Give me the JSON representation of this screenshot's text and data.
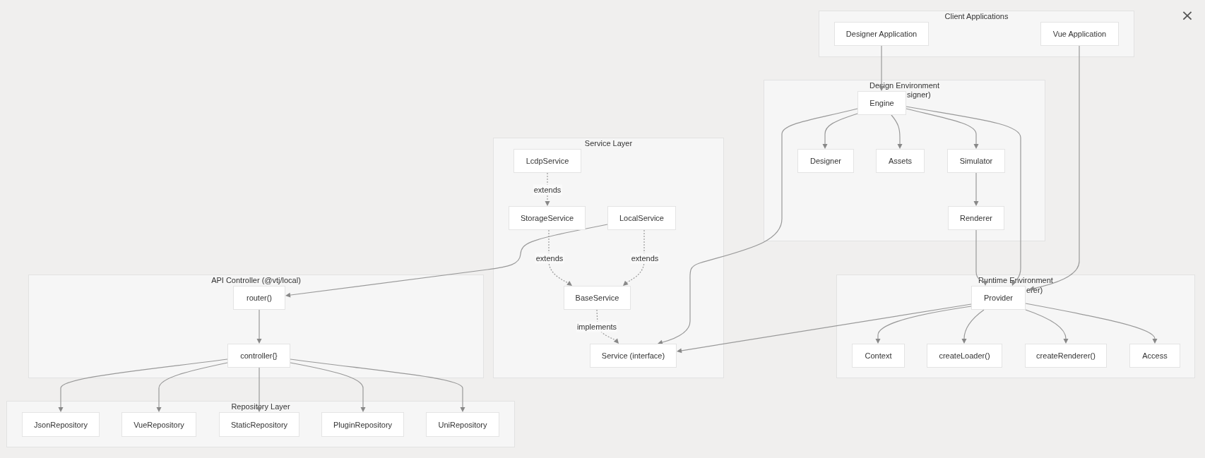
{
  "groups": [
    {
      "title": "Client Applications",
      "nodes": [
        "Designer Application",
        "Vue Application"
      ]
    },
    {
      "title": "Design Environment",
      "title_line_2": "signer)",
      "nodes": [
        "Engine",
        "Designer",
        "Assets",
        "Simulator",
        "Renderer"
      ]
    },
    {
      "title": "API Controller (@vtj/local)",
      "nodes": [
        "router()",
        "controller{}"
      ]
    },
    {
      "title": "Service Layer",
      "nodes": [
        "LcdpService",
        "StorageService",
        "LocalService",
        "BaseService",
        "Service (interface)"
      ]
    },
    {
      "title": "Runtime Environment",
      "title_line_2": "erer)",
      "nodes": [
        "Provider",
        "Context",
        "createLoader()",
        "createRenderer()",
        "Access"
      ]
    },
    {
      "title": "Repository Layer",
      "nodes": [
        "JsonRepository",
        "VueRepository",
        "StaticRepository",
        "PluginRepository",
        "UniRepository"
      ]
    }
  ],
  "edges": [
    {
      "kind": "solid"
    },
    {
      "kind": "solid"
    },
    {
      "kind": "solid"
    },
    {
      "kind": "solid"
    },
    {
      "kind": "solid"
    },
    {
      "kind": "solid"
    },
    {
      "kind": "solid"
    },
    {
      "kind": "solid"
    },
    {
      "kind": "solid"
    },
    {
      "kind": "dotted",
      "label": "extends"
    },
    {
      "kind": "dotted",
      "label": "extends"
    },
    {
      "kind": "dotted",
      "label": "extends"
    },
    {
      "kind": "dotted",
      "label": "implements"
    },
    {
      "kind": "solid"
    },
    {
      "kind": "solid"
    },
    {
      "kind": "solid"
    },
    {
      "kind": "solid"
    },
    {
      "kind": "solid"
    },
    {
      "kind": "solid"
    },
    {
      "kind": "solid"
    },
    {
      "kind": "solid"
    },
    {
      "kind": "solid"
    },
    {
      "kind": "solid"
    },
    {
      "kind": "solid"
    },
    {
      "kind": "solid"
    }
  ],
  "close_button": {
    "label": "×"
  }
}
